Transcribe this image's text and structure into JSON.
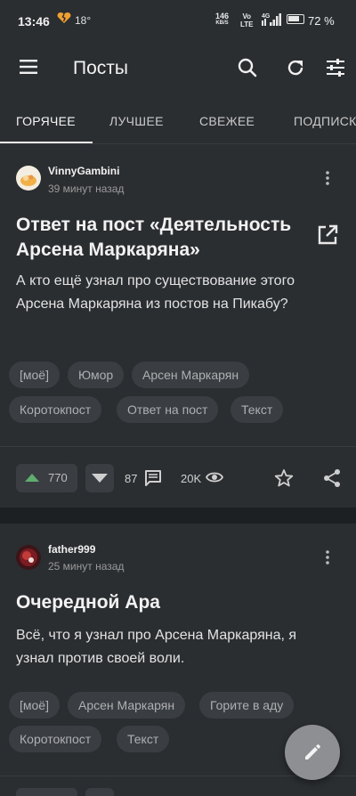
{
  "status_bar": {
    "time": "13:46",
    "temperature": "18°",
    "net_speed_value": "146",
    "net_speed_unit": "KB/S",
    "volte_top": "Vo",
    "volte_bottom": "LTE",
    "network": "4G",
    "battery": "72 %"
  },
  "app_bar": {
    "title": "Посты"
  },
  "tabs": [
    {
      "label": "ГОРЯЧЕЕ",
      "active": true
    },
    {
      "label": "ЛУЧШЕЕ",
      "active": false
    },
    {
      "label": "СВЕЖЕЕ",
      "active": false
    },
    {
      "label": "ПОДПИСКИ",
      "active": false
    }
  ],
  "posts": [
    {
      "author": "VinnyGambini",
      "time_ago": "39 минут назад",
      "title_line1": "Ответ на пост «Деятельность",
      "title_line2": "Арсена Маркаряна»",
      "body_line1": "А кто ещё узнал про существование этого",
      "body_line2": "Арсена Маркаряна из постов на Пикабу?",
      "tags": [
        "[моё]",
        "Юмор",
        "Арсен Маркарян",
        "Коротокпост",
        "Ответ на пост",
        "Текст"
      ],
      "rating": "770",
      "comments": "87",
      "views": "20K"
    },
    {
      "author": "father999",
      "time_ago": "25 минут назад",
      "title_line1": "Очередной Ара",
      "body_line1": "Всё, что я узнал про Арсена Маркаряна, я",
      "body_line2": "узнал против своей воли.",
      "tags": [
        "[моё]",
        "Арсен Маркарян",
        "Горите в аду",
        "Коротокпост",
        "Текст"
      ]
    }
  ],
  "colors": {
    "background": "#1d2023",
    "card": "#2b2e31",
    "chip": "#3a3d41",
    "upvote": "#5fae6e",
    "fab": "#8e8f92"
  }
}
